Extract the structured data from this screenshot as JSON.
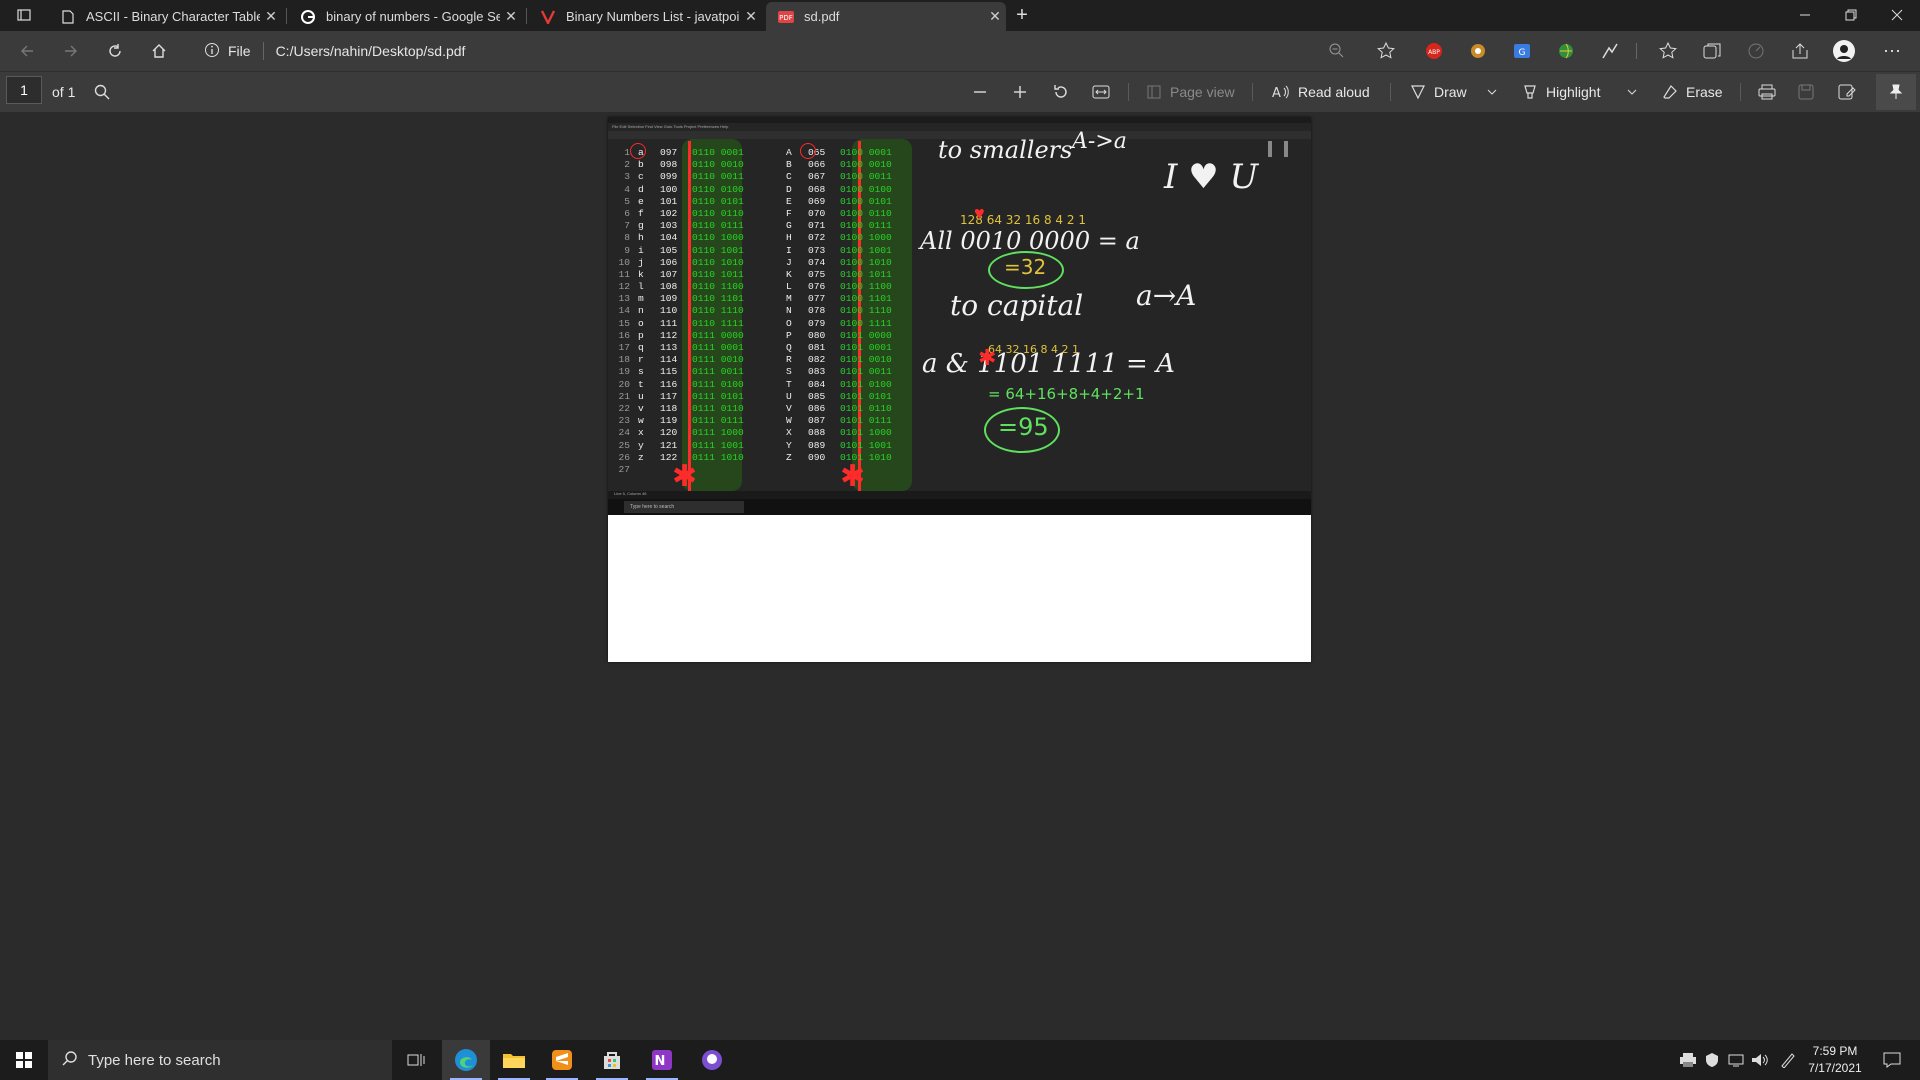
{
  "tabs": [
    {
      "title": "ASCII - Binary Character Table",
      "icon": "document-icon"
    },
    {
      "title": "binary of numbers - Google Sear",
      "icon": "google-icon"
    },
    {
      "title": "Binary Numbers List - javatpoint",
      "icon": "javatpoint-icon"
    },
    {
      "title": "sd.pdf",
      "icon": "pdf-icon",
      "active": true
    }
  ],
  "address": {
    "scheme_label": "File",
    "url": "C:/Users/nahin/Desktop/sd.pdf"
  },
  "pdf_toolbar": {
    "page_number": "1",
    "page_count": "of 1",
    "page_view": "Page view",
    "read_aloud": "Read aloud",
    "draw": "Draw",
    "highlight": "Highlight",
    "erase": "Erase"
  },
  "document": {
    "lowercase_rows": [
      {
        "n": "1",
        "ch": "a",
        "dec": "097",
        "bin": "0110 0001"
      },
      {
        "n": "2",
        "ch": "b",
        "dec": "098",
        "bin": "0110 0010"
      },
      {
        "n": "3",
        "ch": "c",
        "dec": "099",
        "bin": "0110 0011"
      },
      {
        "n": "4",
        "ch": "d",
        "dec": "100",
        "bin": "0110 0100"
      },
      {
        "n": "5",
        "ch": "e",
        "dec": "101",
        "bin": "0110 0101"
      },
      {
        "n": "6",
        "ch": "f",
        "dec": "102",
        "bin": "0110 0110"
      },
      {
        "n": "7",
        "ch": "g",
        "dec": "103",
        "bin": "0110 0111"
      },
      {
        "n": "8",
        "ch": "h",
        "dec": "104",
        "bin": "0110 1000"
      },
      {
        "n": "9",
        "ch": "i",
        "dec": "105",
        "bin": "0110 1001"
      },
      {
        "n": "10",
        "ch": "j",
        "dec": "106",
        "bin": "0110 1010"
      },
      {
        "n": "11",
        "ch": "k",
        "dec": "107",
        "bin": "0110 1011"
      },
      {
        "n": "12",
        "ch": "l",
        "dec": "108",
        "bin": "0110 1100"
      },
      {
        "n": "13",
        "ch": "m",
        "dec": "109",
        "bin": "0110 1101"
      },
      {
        "n": "14",
        "ch": "n",
        "dec": "110",
        "bin": "0110 1110"
      },
      {
        "n": "15",
        "ch": "o",
        "dec": "111",
        "bin": "0110 1111"
      },
      {
        "n": "16",
        "ch": "p",
        "dec": "112",
        "bin": "0111 0000"
      },
      {
        "n": "17",
        "ch": "q",
        "dec": "113",
        "bin": "0111 0001"
      },
      {
        "n": "18",
        "ch": "r",
        "dec": "114",
        "bin": "0111 0010"
      },
      {
        "n": "19",
        "ch": "s",
        "dec": "115",
        "bin": "0111 0011"
      },
      {
        "n": "20",
        "ch": "t",
        "dec": "116",
        "bin": "0111 0100"
      },
      {
        "n": "21",
        "ch": "u",
        "dec": "117",
        "bin": "0111 0101"
      },
      {
        "n": "22",
        "ch": "v",
        "dec": "118",
        "bin": "0111 0110"
      },
      {
        "n": "23",
        "ch": "w",
        "dec": "119",
        "bin": "0111 0111"
      },
      {
        "n": "24",
        "ch": "x",
        "dec": "120",
        "bin": "0111 1000"
      },
      {
        "n": "25",
        "ch": "y",
        "dec": "121",
        "bin": "0111 1001"
      },
      {
        "n": "26",
        "ch": "z",
        "dec": "122",
        "bin": "0111 1010"
      },
      {
        "n": "27",
        "ch": "",
        "dec": "",
        "bin": ""
      }
    ],
    "uppercase_rows": [
      {
        "ch": "A",
        "dec": "065",
        "bin": "0100 0001"
      },
      {
        "ch": "B",
        "dec": "066",
        "bin": "0100 0010"
      },
      {
        "ch": "C",
        "dec": "067",
        "bin": "0100 0011"
      },
      {
        "ch": "D",
        "dec": "068",
        "bin": "0100 0100"
      },
      {
        "ch": "E",
        "dec": "069",
        "bin": "0100 0101"
      },
      {
        "ch": "F",
        "dec": "070",
        "bin": "0100 0110"
      },
      {
        "ch": "G",
        "dec": "071",
        "bin": "0100 0111"
      },
      {
        "ch": "H",
        "dec": "072",
        "bin": "0100 1000"
      },
      {
        "ch": "I",
        "dec": "073",
        "bin": "0100 1001"
      },
      {
        "ch": "J",
        "dec": "074",
        "bin": "0100 1010"
      },
      {
        "ch": "K",
        "dec": "075",
        "bin": "0100 1011"
      },
      {
        "ch": "L",
        "dec": "076",
        "bin": "0100 1100"
      },
      {
        "ch": "M",
        "dec": "077",
        "bin": "0100 1101"
      },
      {
        "ch": "N",
        "dec": "078",
        "bin": "0100 1110"
      },
      {
        "ch": "O",
        "dec": "079",
        "bin": "0100 1111"
      },
      {
        "ch": "P",
        "dec": "080",
        "bin": "0101 0000"
      },
      {
        "ch": "Q",
        "dec": "081",
        "bin": "0101 0001"
      },
      {
        "ch": "R",
        "dec": "082",
        "bin": "0101 0010"
      },
      {
        "ch": "S",
        "dec": "083",
        "bin": "0101 0011"
      },
      {
        "ch": "T",
        "dec": "084",
        "bin": "0101 0100"
      },
      {
        "ch": "U",
        "dec": "085",
        "bin": "0101 0101"
      },
      {
        "ch": "V",
        "dec": "086",
        "bin": "0101 0110"
      },
      {
        "ch": "W",
        "dec": "087",
        "bin": "0101 0111"
      },
      {
        "ch": "X",
        "dec": "088",
        "bin": "0101 1000"
      },
      {
        "ch": "Y",
        "dec": "089",
        "bin": "0101 1001"
      },
      {
        "ch": "Z",
        "dec": "090",
        "bin": "0101 1010"
      }
    ],
    "notes": {
      "to_smaller": "to smallers",
      "a_to_a_lower": "A->a",
      "love": "I ♥ U",
      "bits_a": "128 64 32 16  8 4 2 1",
      "all_eq": "All 0010 0000 = a",
      "sum1": "=32",
      "to_capital": "to capital",
      "a_to_a_upper": "a→A",
      "bits_b": "64 32 16  8 4 2 1",
      "and_eq": "a & 1101 1111 = A",
      "sum_expr": "= 64+16+8+4+2+1",
      "sum2": "=95"
    },
    "mini_menu": "File  Edit  Selection  Find  View  Goto  Tools  Project  Preferences  Help",
    "mini_status": "Line 5, Column 46",
    "mini_search": "Type here to search"
  },
  "taskbar": {
    "search_placeholder": "Type here to search",
    "time": "7:59 PM",
    "date": "7/17/2021"
  },
  "colors": {
    "accent_green": "#27d327",
    "ink_red": "#ff2a2a",
    "highlight_green": "#2a6414"
  }
}
